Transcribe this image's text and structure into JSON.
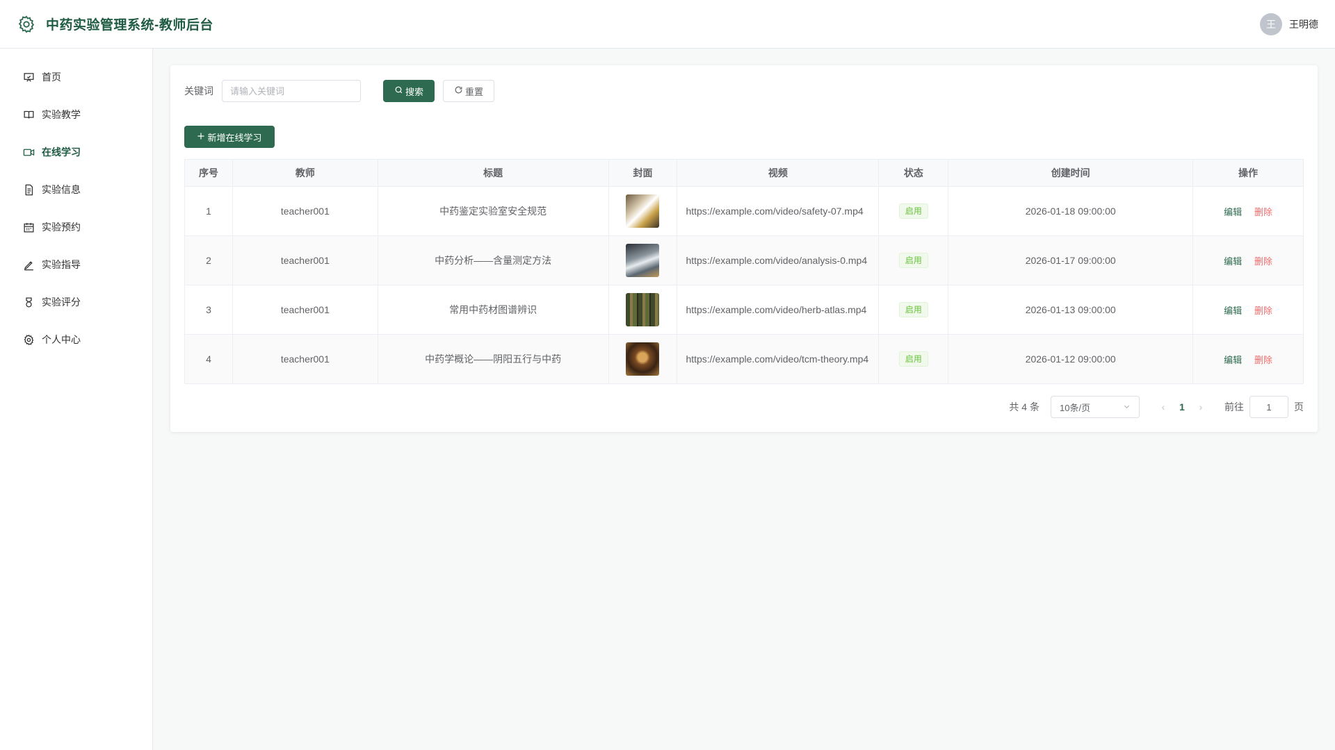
{
  "header": {
    "title": "中药实验管理系统-教师后台",
    "user": {
      "avatar_initial": "王",
      "name": "王明德"
    }
  },
  "sidebar": {
    "items": [
      {
        "label": "首页",
        "icon": "presentation-icon",
        "active": false
      },
      {
        "label": "实验教学",
        "icon": "book-icon",
        "active": false
      },
      {
        "label": "在线学习",
        "icon": "video-icon",
        "active": true
      },
      {
        "label": "实验信息",
        "icon": "document-icon",
        "active": false
      },
      {
        "label": "实验预约",
        "icon": "calendar-icon",
        "active": false
      },
      {
        "label": "实验指导",
        "icon": "pen-icon",
        "active": false
      },
      {
        "label": "实验评分",
        "icon": "medal-icon",
        "active": false
      },
      {
        "label": "个人中心",
        "icon": "gear-icon",
        "active": false
      }
    ]
  },
  "search": {
    "label": "关键词",
    "placeholder": "请输入关键词",
    "value": "",
    "search_label": "搜索",
    "reset_label": "重置"
  },
  "toolbar": {
    "add_label": "新增在线学习"
  },
  "table": {
    "columns": [
      "序号",
      "教师",
      "标题",
      "封面",
      "视频",
      "状态",
      "创建时间",
      "操作"
    ],
    "rows": [
      {
        "index": "1",
        "teacher": "teacher001",
        "title": "中药鉴定实验室安全规范",
        "video": "https://example.com/video/safety-07.mp4",
        "status": "启用",
        "created": "2026-01-18 09:00:00",
        "edit": "编辑",
        "delete": "删除"
      },
      {
        "index": "2",
        "teacher": "teacher001",
        "title": "中药分析——含量测定方法",
        "video": "https://example.com/video/analysis-0.mp4",
        "status": "启用",
        "created": "2026-01-17 09:00:00",
        "edit": "编辑",
        "delete": "删除"
      },
      {
        "index": "3",
        "teacher": "teacher001",
        "title": "常用中药材图谱辨识",
        "video": "https://example.com/video/herb-atlas.mp4",
        "status": "启用",
        "created": "2026-01-13 09:00:00",
        "edit": "编辑",
        "delete": "删除"
      },
      {
        "index": "4",
        "teacher": "teacher001",
        "title": "中药学概论——阴阳五行与中药",
        "video": "https://example.com/video/tcm-theory.mp4",
        "status": "启用",
        "created": "2026-01-12 09:00:00",
        "edit": "编辑",
        "delete": "删除"
      }
    ]
  },
  "pagination": {
    "total": "共 4 条",
    "page_size": "10条/页",
    "current_page": "1",
    "goto_label": "前往",
    "goto_value": "1",
    "page_unit": "页"
  },
  "colors": {
    "primary": "#2d6a4f",
    "danger": "#f56c6c",
    "success": "#67c23a"
  }
}
